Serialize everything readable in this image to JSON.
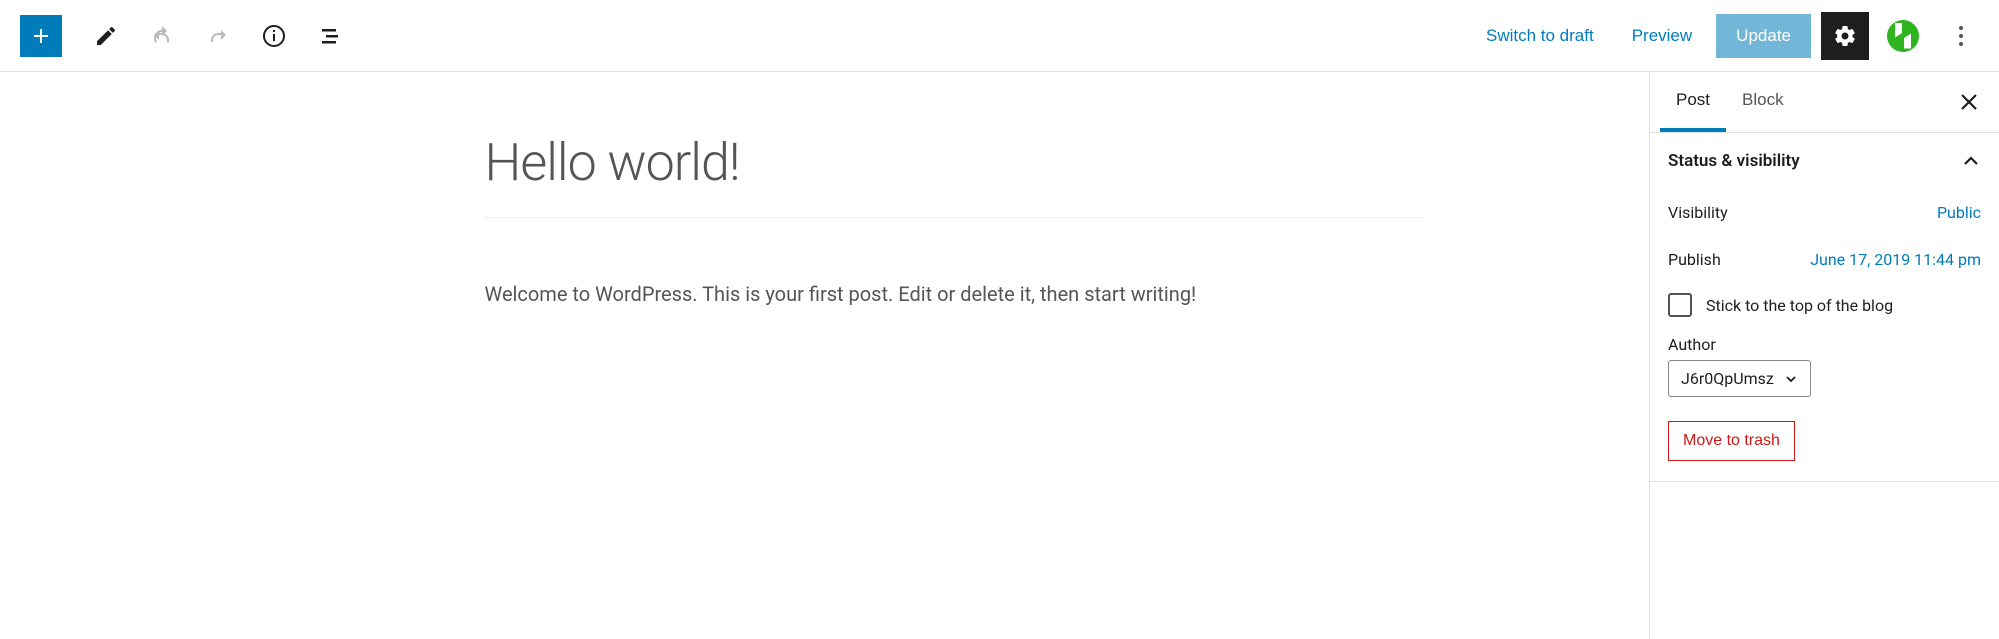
{
  "toolbar": {
    "switch_to_draft": "Switch to draft",
    "preview": "Preview",
    "update": "Update"
  },
  "editor": {
    "title": "Hello world!",
    "body": "Welcome to WordPress. This is your first post. Edit or delete it, then start writing!"
  },
  "sidebar": {
    "tabs": {
      "post": "Post",
      "block": "Block"
    },
    "panels": {
      "status": {
        "title": "Status & visibility",
        "visibility_label": "Visibility",
        "visibility_value": "Public",
        "publish_label": "Publish",
        "publish_value": "June 17, 2019 11:44 pm",
        "sticky_label": "Stick to the top of the blog",
        "author_label": "Author",
        "author_value": "J6r0QpUmsz",
        "trash_label": "Move to trash"
      }
    }
  }
}
